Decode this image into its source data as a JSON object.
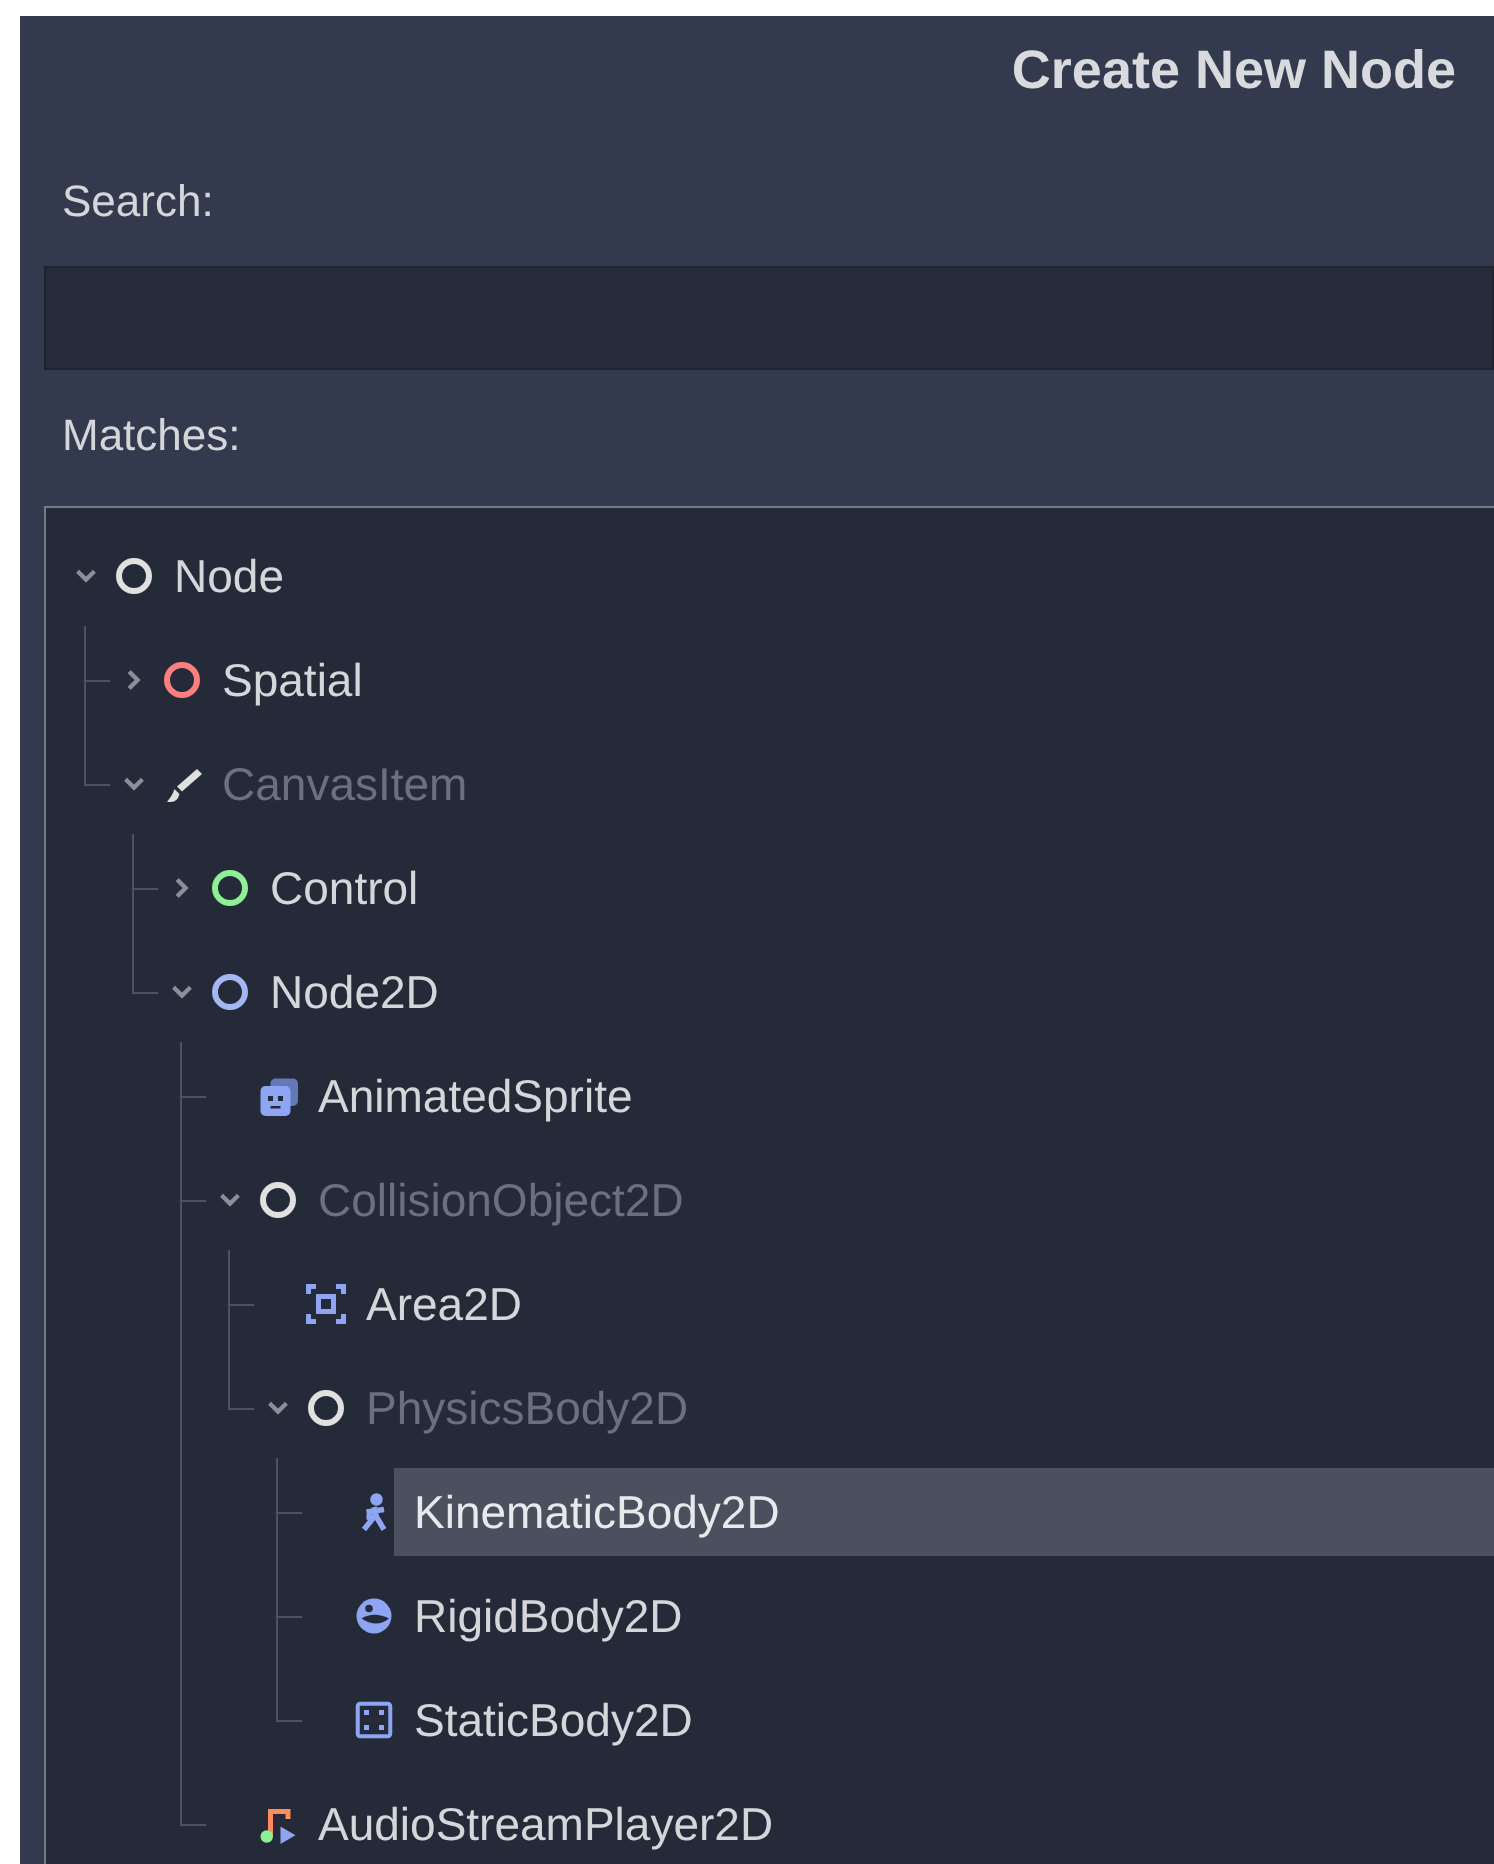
{
  "dialog": {
    "title": "Create New Node"
  },
  "search": {
    "label": "Search:"
  },
  "matches": {
    "label": "Matches:"
  },
  "tree": [
    {
      "label": "Node",
      "kind": "circle",
      "color": "#e0e0e0",
      "expanded": true,
      "disabled": false,
      "selected": false,
      "children": [
        {
          "label": "Spatial",
          "kind": "circle",
          "color": "#fc7f7f",
          "expanded": false,
          "disabled": false,
          "selected": false
        },
        {
          "label": "CanvasItem",
          "kind": "brush",
          "expanded": true,
          "disabled": true,
          "selected": false,
          "children": [
            {
              "label": "Control",
              "kind": "circle",
              "color": "#8eef97",
              "expanded": false,
              "disabled": false,
              "selected": false
            },
            {
              "label": "Node2D",
              "kind": "circle",
              "color": "#a5b7f3",
              "expanded": true,
              "disabled": false,
              "selected": false,
              "children": [
                {
                  "label": "AnimatedSprite",
                  "kind": "sprite",
                  "disabled": false,
                  "selected": false
                },
                {
                  "label": "CollisionObject2D",
                  "kind": "circle",
                  "color": "#e0e0e0",
                  "expanded": true,
                  "disabled": true,
                  "selected": false,
                  "children": [
                    {
                      "label": "Area2D",
                      "kind": "area",
                      "disabled": false,
                      "selected": false
                    },
                    {
                      "label": "PhysicsBody2D",
                      "kind": "circle",
                      "color": "#e0e0e0",
                      "expanded": true,
                      "disabled": true,
                      "selected": false,
                      "children": [
                        {
                          "label": "KinematicBody2D",
                          "kind": "kinematic",
                          "disabled": false,
                          "selected": true
                        },
                        {
                          "label": "RigidBody2D",
                          "kind": "rigid",
                          "disabled": false,
                          "selected": false
                        },
                        {
                          "label": "StaticBody2D",
                          "kind": "static",
                          "disabled": false,
                          "selected": false
                        }
                      ]
                    }
                  ]
                },
                {
                  "label": "AudioStreamPlayer2D",
                  "kind": "audio",
                  "disabled": false,
                  "selected": false
                }
              ]
            }
          ]
        }
      ]
    }
  ]
}
